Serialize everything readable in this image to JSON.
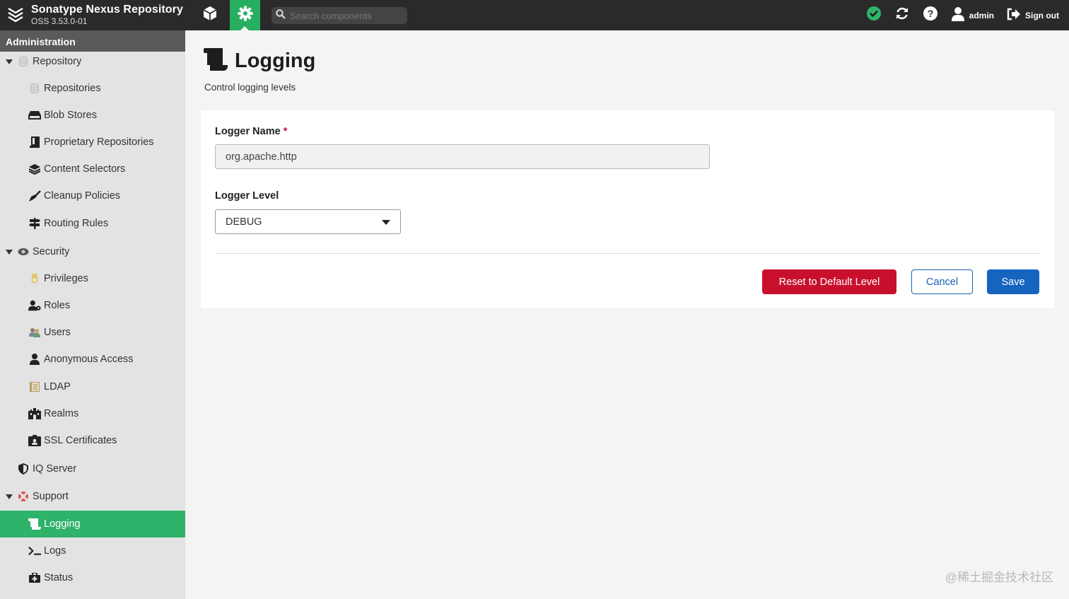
{
  "app": {
    "name": "Sonatype Nexus Repository",
    "version": "OSS 3.53.0-01"
  },
  "topbar": {
    "search_placeholder": "Search components",
    "user": "admin",
    "signout": "Sign out",
    "icons": [
      "cube-icon",
      "gear-icon",
      "search-icon",
      "check-circle-icon",
      "refresh-icon",
      "help-icon",
      "user-icon",
      "signout-icon"
    ],
    "accent_color": "#27ae60"
  },
  "sidebar": {
    "header": "Administration",
    "items": [
      {
        "label": "Repository",
        "level": 0,
        "expanded": true,
        "icon": "database-icon"
      },
      {
        "label": "Repositories",
        "level": 1,
        "icon": "database-icon"
      },
      {
        "label": "Blob Stores",
        "level": 1,
        "icon": "hdd-icon"
      },
      {
        "label": "Proprietary Repositories",
        "level": 1,
        "icon": "book-icon"
      },
      {
        "label": "Content Selectors",
        "level": 1,
        "icon": "layers-icon"
      },
      {
        "label": "Cleanup Policies",
        "level": 1,
        "icon": "broom-icon"
      },
      {
        "label": "Routing Rules",
        "level": 1,
        "icon": "signpost-icon"
      },
      {
        "label": "Security",
        "level": 0,
        "expanded": true,
        "icon": "eye-icon"
      },
      {
        "label": "Privileges",
        "level": 1,
        "icon": "medal-icon"
      },
      {
        "label": "Roles",
        "level": 1,
        "icon": "user-gear-icon"
      },
      {
        "label": "Users",
        "level": 1,
        "icon": "users-icon"
      },
      {
        "label": "Anonymous Access",
        "level": 1,
        "icon": "user-icon"
      },
      {
        "label": "LDAP",
        "level": 1,
        "icon": "book-open-icon"
      },
      {
        "label": "Realms",
        "level": 1,
        "icon": "castle-icon"
      },
      {
        "label": "SSL Certificates",
        "level": 1,
        "icon": "id-card-icon"
      },
      {
        "label": "IQ Server",
        "level": 0,
        "icon": "shield-icon"
      },
      {
        "label": "Support",
        "level": 0,
        "expanded": true,
        "icon": "lifebuoy-icon"
      },
      {
        "label": "Logging",
        "level": 1,
        "active": true,
        "icon": "scroll-icon"
      },
      {
        "label": "Logs",
        "level": 1,
        "icon": "terminal-icon"
      },
      {
        "label": "Status",
        "level": 1,
        "icon": "medkit-icon"
      }
    ]
  },
  "page": {
    "title": "Logging",
    "subtitle": "Control logging levels",
    "title_icon": "scroll-icon"
  },
  "form": {
    "logger_name_label": "Logger Name",
    "required_mark": "*",
    "logger_name_value": "org.apache.http",
    "logger_level_label": "Logger Level",
    "logger_level_value": "DEBUG",
    "reset_label": "Reset to Default Level",
    "cancel_label": "Cancel",
    "save_label": "Save"
  },
  "watermark": "@稀土掘金技术社区"
}
